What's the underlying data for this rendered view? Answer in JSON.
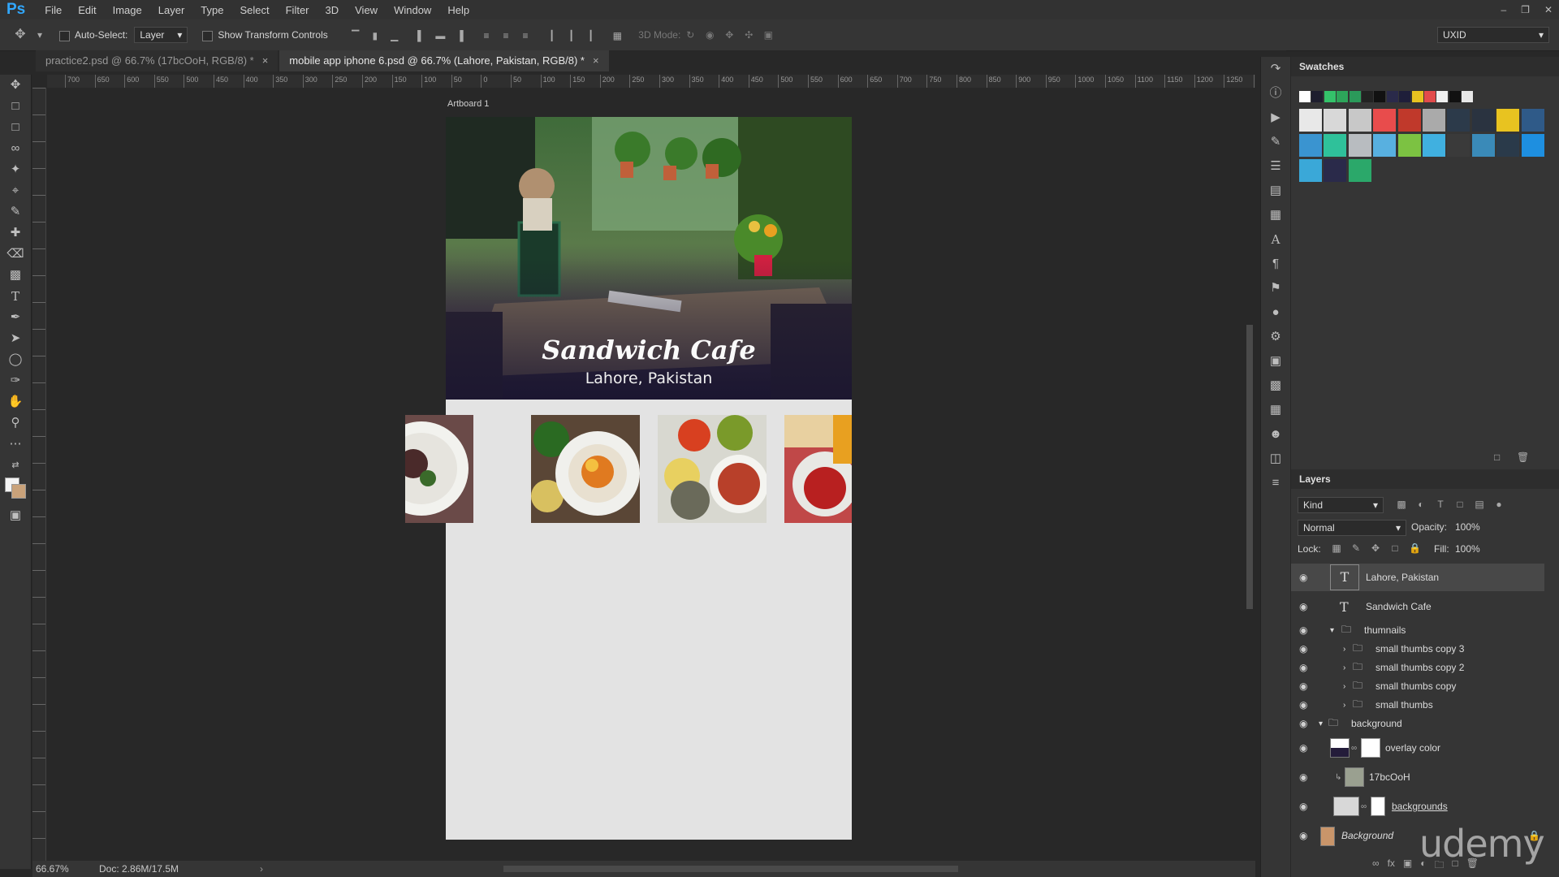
{
  "app": {
    "logo": "Ps"
  },
  "menu": [
    "File",
    "Edit",
    "Image",
    "Layer",
    "Type",
    "Select",
    "Filter",
    "3D",
    "View",
    "Window",
    "Help"
  ],
  "options": {
    "auto_select_label": "Auto-Select:",
    "auto_select_value": "Layer",
    "transform_label": "Show Transform Controls",
    "mode3d_label": "3D Mode:",
    "workspace": "UXID"
  },
  "tabs": [
    {
      "label": "practice2.psd @ 66.7% (17bcOoH, RGB/8) *"
    },
    {
      "label": "mobile app iphone 6.psd @ 66.7% (Lahore, Pakistan, RGB/8) *"
    }
  ],
  "ruler_top": [
    "700",
    "650",
    "600",
    "550",
    "500",
    "450",
    "400",
    "350",
    "300",
    "250",
    "200",
    "150",
    "100",
    "50",
    "0",
    "50",
    "100",
    "150",
    "200",
    "250",
    "300",
    "350",
    "400",
    "450",
    "500",
    "550",
    "600",
    "650",
    "700",
    "750",
    "800",
    "850",
    "900",
    "950",
    "1000",
    "1050",
    "1100",
    "1150",
    "1200",
    "1250",
    "14"
  ],
  "artboard": {
    "label": "Artboard 1",
    "title": "Sandwich Cafe",
    "subtitle": "Lahore, Pakistan"
  },
  "status": {
    "zoom": "66.67%",
    "doc": "Doc: 2.86M/17.5M"
  },
  "swatches": {
    "title": "Swatches",
    "small": [
      "#ffffff",
      "#1e1e2e",
      "#34c26a",
      "#2da55a",
      "#2b9a5a",
      "#222222",
      "#111111",
      "#2a2a4a",
      "#1e1e3a",
      "#e8c320",
      "#e24b4b",
      "#f0f0f0",
      "#111111",
      "#e8e8e8"
    ],
    "large": [
      "#e8e8e8",
      "#d8d8d8",
      "#c8c8c8",
      "#e84c4c",
      "#c0392b",
      "#aaaaaa",
      "#2c3a4a",
      "#2a3340",
      "#e8c320",
      "#2f5a88",
      "#3a94d0",
      "#2fc19a",
      "#b8bcc0",
      "#58b0e0",
      "#7cc242",
      "#40b0e0",
      "#3a3a3a",
      "#3a8ab8",
      "#2a3a4a",
      "#1e8fe0",
      "#3aa8d8",
      "#2a2a4a",
      "#2ba86a"
    ]
  },
  "layers": {
    "title": "Layers",
    "kind": "Kind",
    "blend": "Normal",
    "opacity_label": "Opacity:",
    "opacity": "100%",
    "lock_label": "Lock:",
    "fill_label": "Fill:",
    "fill": "100%",
    "items": [
      "Lahore, Pakistan",
      "Sandwich Cafe",
      "thumnails",
      "small thumbs copy 3",
      "small thumbs copy 2",
      "small thumbs copy",
      "small thumbs",
      "background",
      "overlay color",
      "17bcOoH",
      "backgrounds",
      "Background"
    ]
  },
  "watermark": "udemy"
}
